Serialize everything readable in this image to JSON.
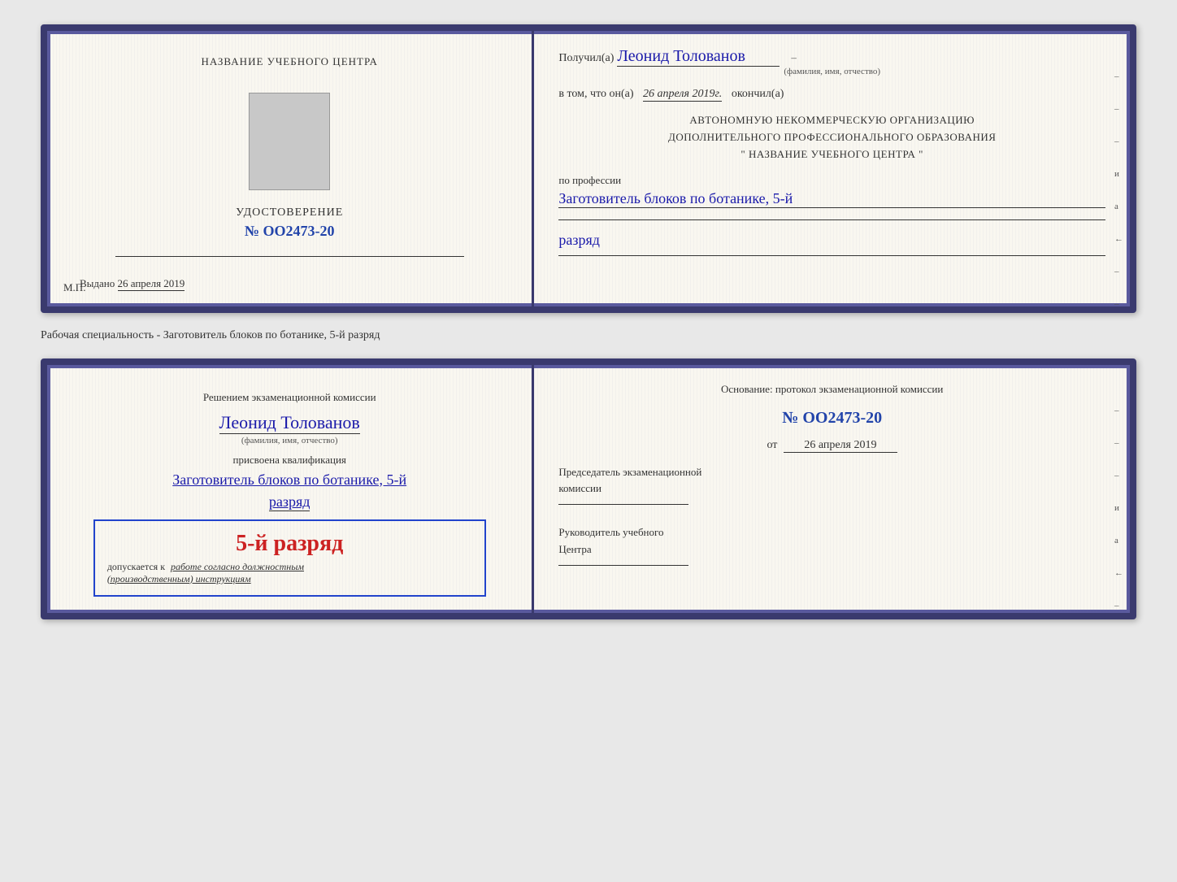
{
  "doc1": {
    "left": {
      "org_title": "НАЗВАНИЕ УЧЕБНОГО ЦЕНТРА",
      "cert_label": "УДОСТОВЕРЕНИЕ",
      "cert_number": "№ OO2473-20",
      "issued_label": "Выдано",
      "issued_date": "26 апреля 2019",
      "mp_label": "М.П."
    },
    "right": {
      "received_prefix": "Получил(а)",
      "received_name": "Леонид Толованов",
      "fio_subtitle": "(фамилия, имя, отчество)",
      "date_prefix": "в том, что он(а)",
      "date_value": "26 апреля 2019г.",
      "date_suffix": "окончил(а)",
      "org_line1": "АВТОНОМНУЮ НЕКОММЕРЧЕСКУЮ ОРГАНИЗАЦИЮ",
      "org_line2": "ДОПОЛНИТЕЛЬНОГО ПРОФЕССИОНАЛЬНОГО ОБРАЗОВАНИЯ",
      "org_line3": "\" НАЗВАНИЕ УЧЕБНОГО ЦЕНТРА \"",
      "profession_label": "по профессии",
      "profession_value": "Заготовитель блоков по ботанике, 5-й",
      "rank_value": "разряд"
    }
  },
  "specialty_label": "Рабочая специальность - Заготовитель блоков по ботанике, 5-й разряд",
  "doc2": {
    "left": {
      "decision_text": "Решением экзаменационной комиссии",
      "person_name": "Леонид Толованов",
      "fio_subtitle": "(фамилия, имя, отчество)",
      "assigned_label": "присвоена квалификация",
      "qualification_value": "Заготовитель блоков по ботанике, 5-й",
      "rank_value": "разряд",
      "stamp_rank": "5-й разряд",
      "allowed_prefix": "допускается к",
      "allowed_value": "работе согласно должностным",
      "instructions": "(производственным) инструкциям"
    },
    "right": {
      "basis_label": "Основание: протокол экзаменационной комиссии",
      "protocol_number": "№ OO2473-20",
      "date_prefix": "от",
      "protocol_date": "26 апреля 2019",
      "chair_label": "Председатель экзаменационной",
      "chair_label2": "комиссии",
      "head_label": "Руководитель учебного",
      "head_label2": "Центра"
    }
  },
  "side_marks": [
    "-",
    "-",
    "-",
    "и",
    "а",
    "←",
    "-",
    "-",
    "-",
    "-"
  ]
}
